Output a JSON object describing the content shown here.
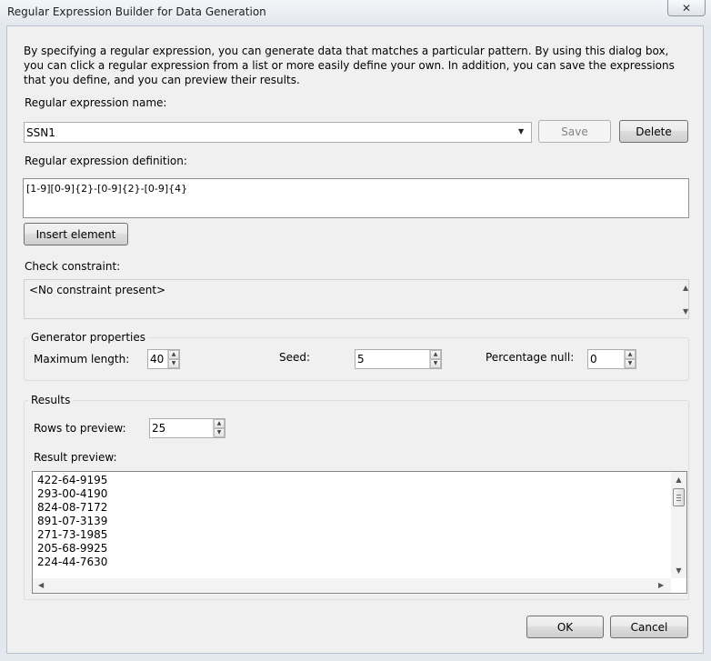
{
  "window": {
    "title": "Regular Expression Builder for Data Generation",
    "close_glyph": "✕"
  },
  "intro_text": "By specifying a regular expression, you can generate data that matches a particular pattern. By using this dialog box, you can click a regular expression from a list or more easily define your own. In addition, you can save the expressions that you define, and you can preview their results.",
  "name_section": {
    "label": "Regular expression name:",
    "value": "SSN1",
    "dropdown_glyph": "▼",
    "save_label": "Save",
    "delete_label": "Delete"
  },
  "definition_section": {
    "label": "Regular expression definition:",
    "value": "[1-9][0-9]{2}-[0-9]{2}-[0-9]{4}",
    "insert_label": "Insert element"
  },
  "constraint_section": {
    "label": "Check constraint:",
    "value": "<No constraint present>"
  },
  "generator": {
    "title": "Generator properties",
    "max_length_label": "Maximum length:",
    "max_length_value": "40",
    "seed_label": "Seed:",
    "seed_value": "5",
    "pct_null_label": "Percentage null:",
    "pct_null_value": "0"
  },
  "results": {
    "title": "Results",
    "rows_label": "Rows to preview:",
    "rows_value": "25",
    "preview_label": "Result preview:",
    "preview_lines": [
      "422-64-9195",
      "293-00-4190",
      "824-08-7172",
      "891-07-3139",
      "271-73-1985",
      "205-68-9925",
      "224-44-7630"
    ]
  },
  "footer": {
    "ok_label": "OK",
    "cancel_label": "Cancel"
  },
  "icons": {
    "spin_up": "▲",
    "spin_down": "▼",
    "scroll_up": "▲",
    "scroll_down": "▼",
    "scroll_left": "◀",
    "scroll_right": "▶"
  }
}
